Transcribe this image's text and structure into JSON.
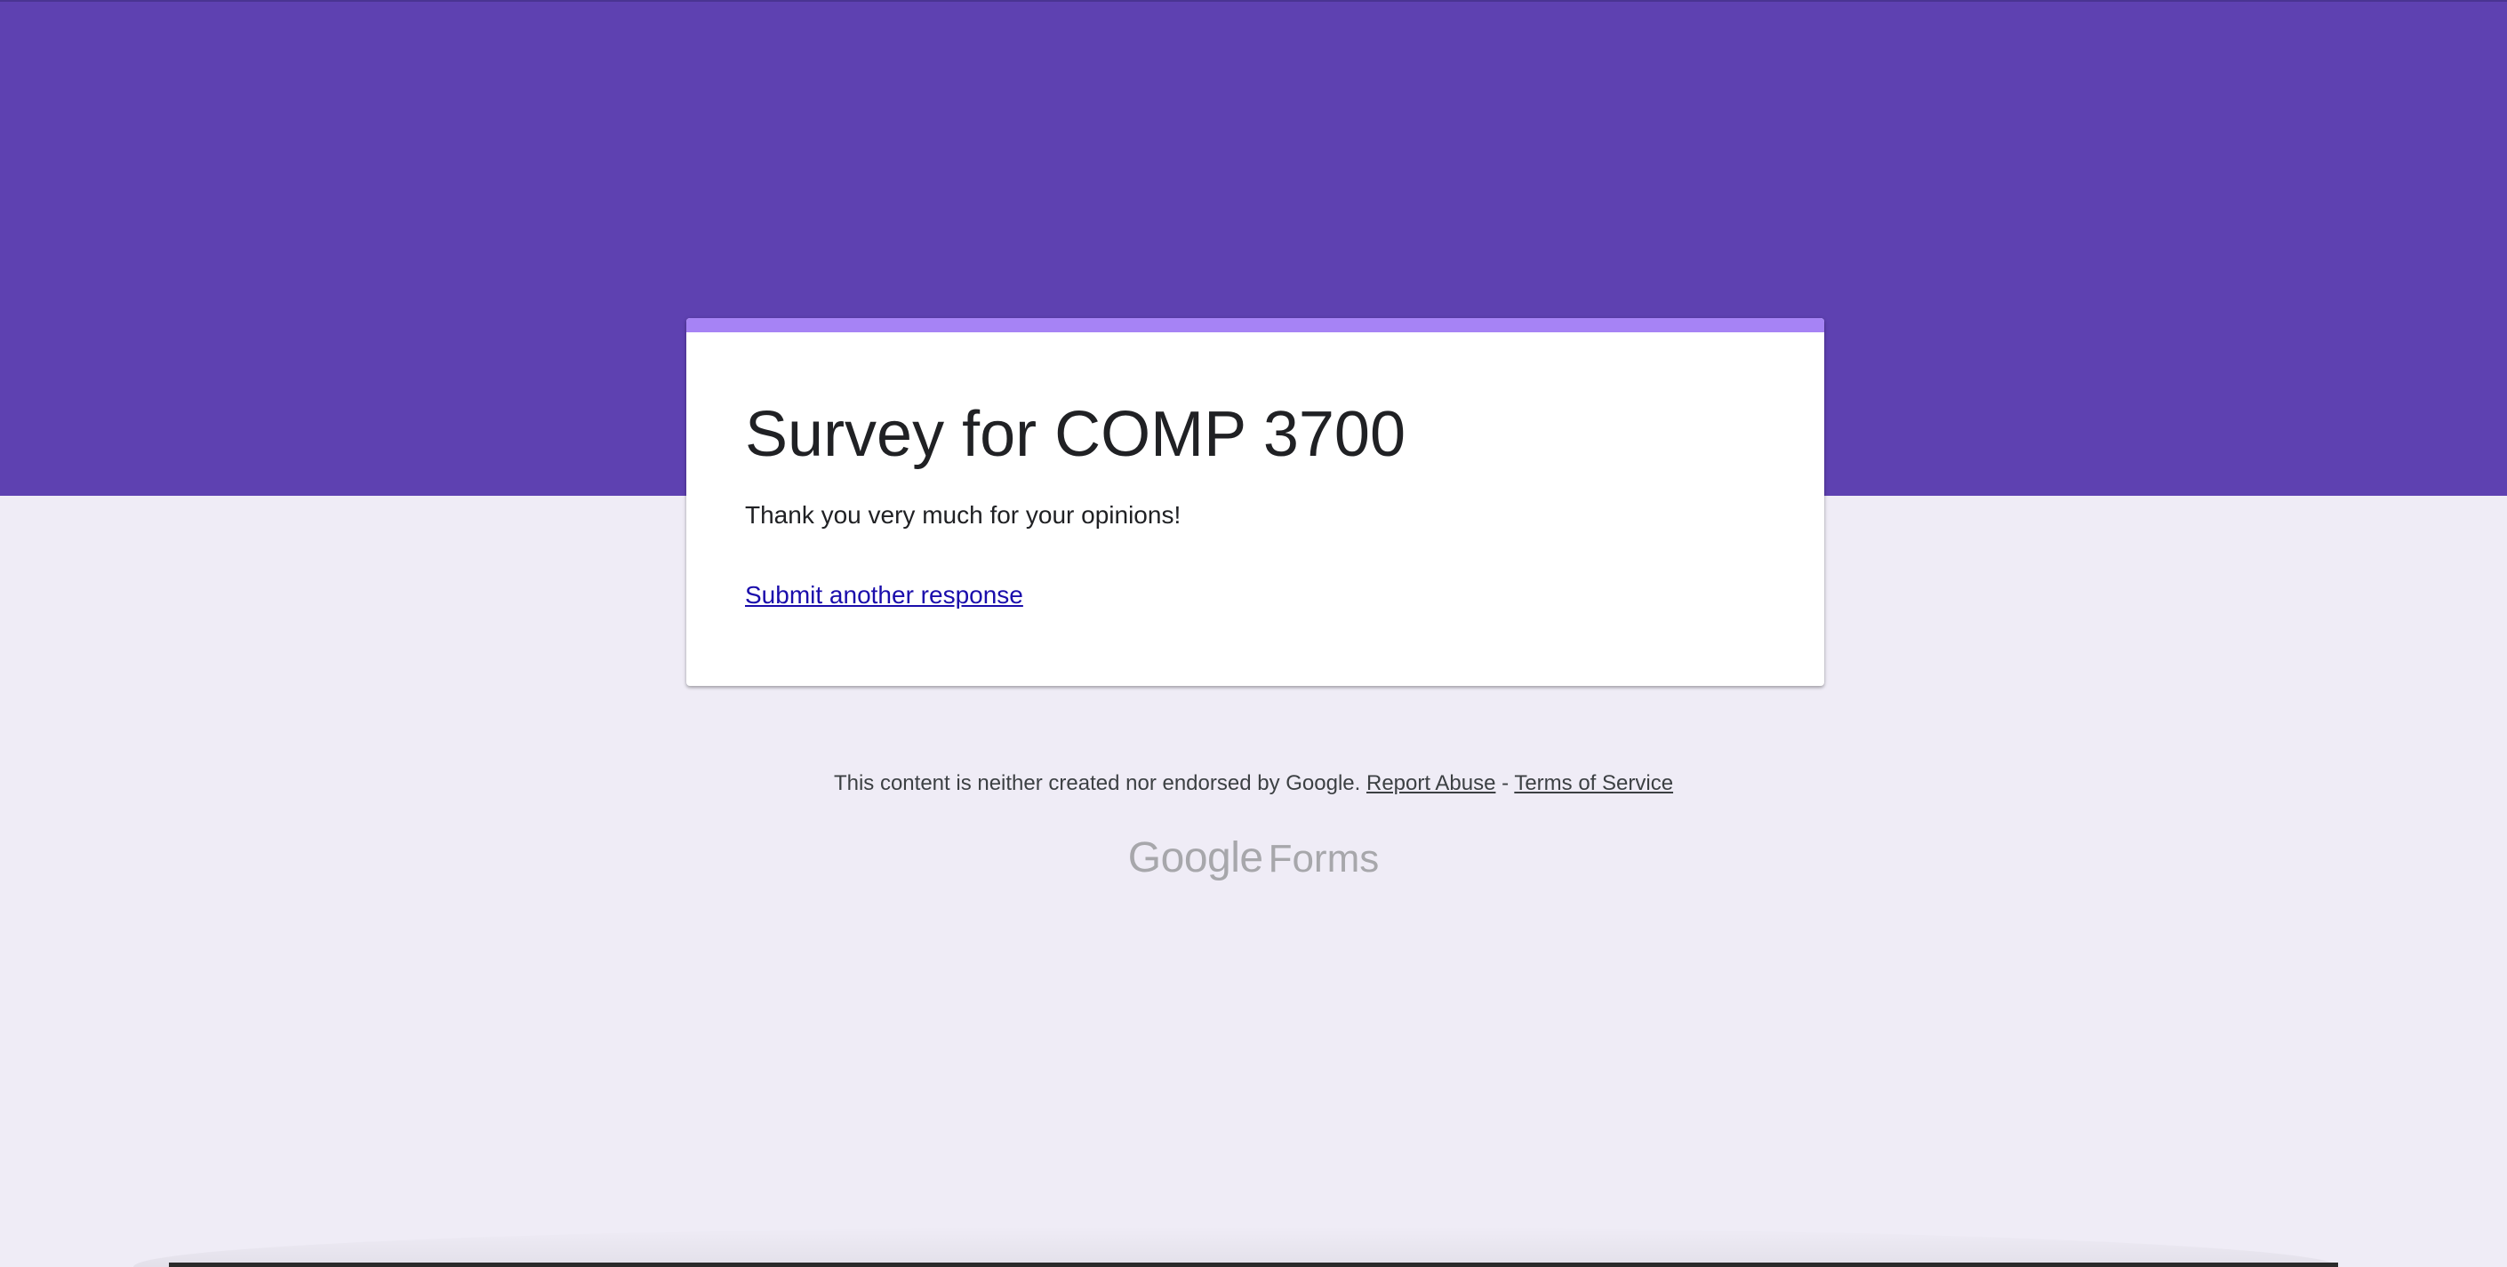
{
  "form": {
    "title": "Survey for COMP 3700",
    "confirmation_message": "Thank you very much for your opinions!",
    "submit_another_label": "Submit another response"
  },
  "footer": {
    "disclaimer": "This content is neither created nor endorsed by Google.",
    "report_abuse_label": "Report Abuse",
    "separator": " - ",
    "terms_label": "Terms of Service"
  },
  "logo": {
    "brand": "Google",
    "product": "Forms"
  },
  "colors": {
    "banner": "#5e41b1",
    "accent": "#a683f5",
    "background": "#efecf6",
    "link": "#1a0dab"
  }
}
